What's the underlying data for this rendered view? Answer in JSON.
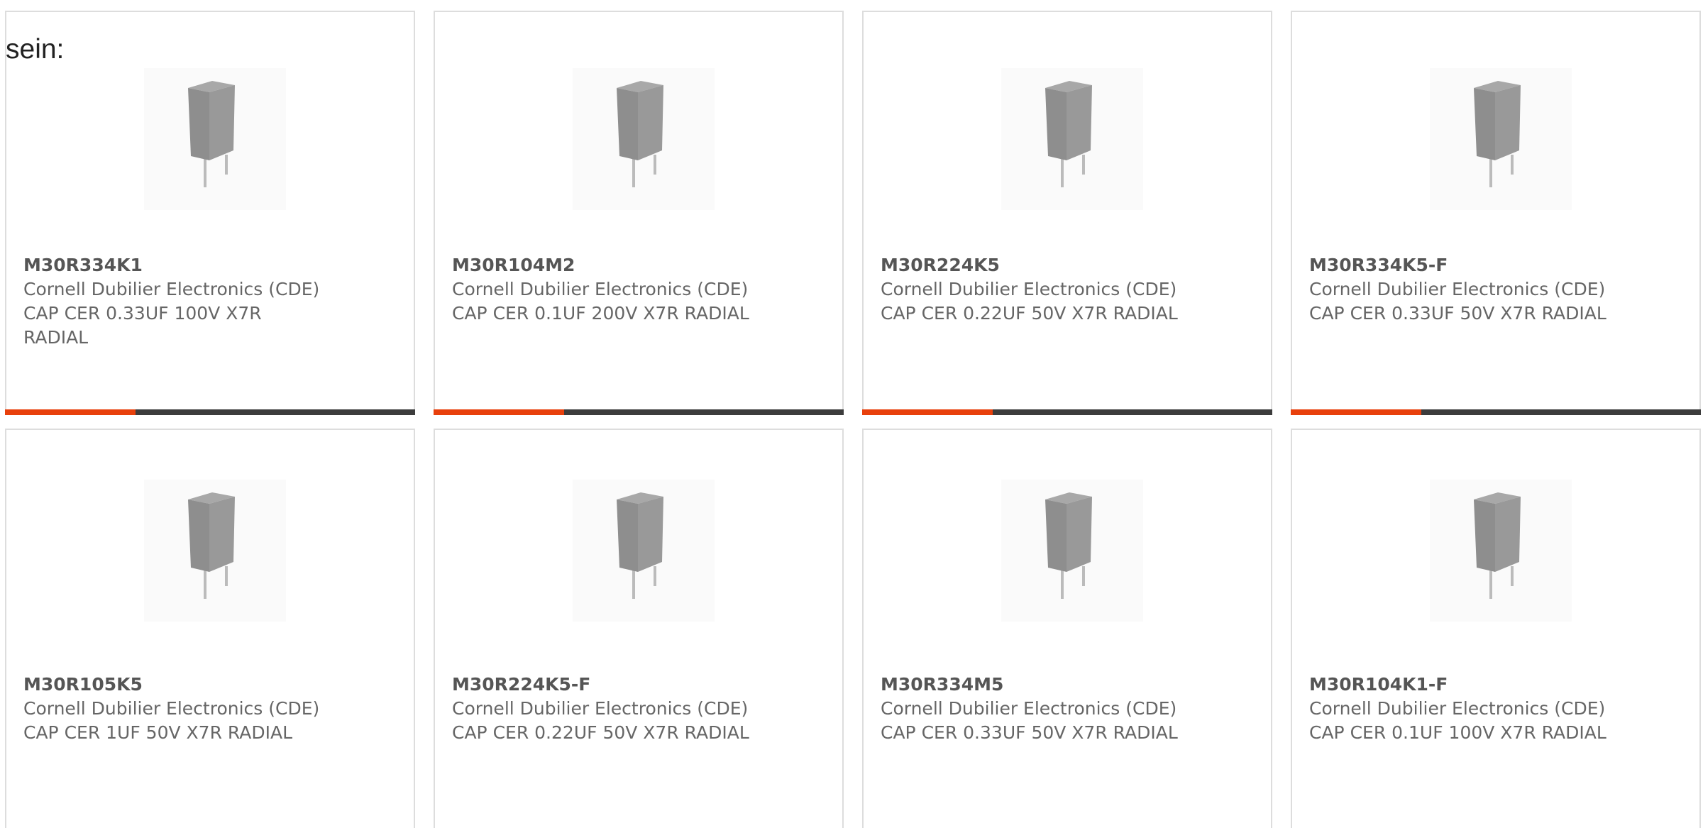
{
  "intro_text": "sein:",
  "accent_color": "#e8400c",
  "bar_color": "#3c3c3c",
  "products": [
    {
      "part": "M30R334K1",
      "manufacturer": "Cornell Dubilier Electronics (CDE)",
      "description": "CAP CER 0.33UF 100V X7R RADIAL"
    },
    {
      "part": "M30R104M2",
      "manufacturer": "Cornell Dubilier Electronics (CDE)",
      "description": "CAP CER 0.1UF 200V X7R RADIAL"
    },
    {
      "part": "M30R224K5",
      "manufacturer": "Cornell Dubilier Electronics (CDE)",
      "description": "CAP CER 0.22UF 50V X7R RADIAL"
    },
    {
      "part": "M30R334K5-F",
      "manufacturer": "Cornell Dubilier Electronics (CDE)",
      "description": "CAP CER 0.33UF 50V X7R RADIAL"
    },
    {
      "part": "M30R105K5",
      "manufacturer": "Cornell Dubilier Electronics (CDE)",
      "description": "CAP CER 1UF 50V X7R RADIAL"
    },
    {
      "part": "M30R224K5-F",
      "manufacturer": "Cornell Dubilier Electronics (CDE)",
      "description": "CAP CER 0.22UF 50V X7R RADIAL"
    },
    {
      "part": "M30R334M5",
      "manufacturer": "Cornell Dubilier Electronics (CDE)",
      "description": "CAP CER 0.33UF 50V X7R RADIAL"
    },
    {
      "part": "M30R104K1-F",
      "manufacturer": "Cornell Dubilier Electronics (CDE)",
      "description": "CAP CER 0.1UF 100V X7R RADIAL"
    }
  ]
}
